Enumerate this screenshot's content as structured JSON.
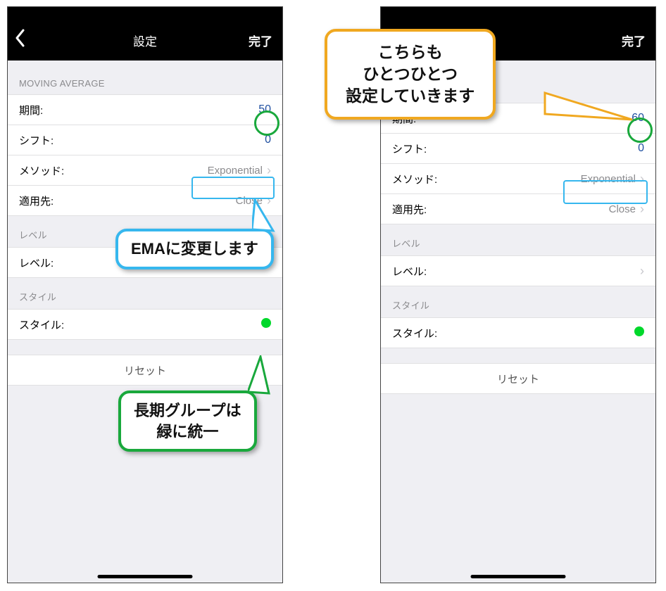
{
  "left": {
    "nav": {
      "back_icon_name": "chevron-left-icon",
      "title": "設定",
      "done": "完了"
    },
    "section1_header": "MOVING AVERAGE",
    "rows": {
      "period_label": "期間:",
      "period_value": "50",
      "shift_label": "シフト:",
      "shift_value": "0",
      "method_label": "メソッド:",
      "method_value": "Exponential",
      "apply_label": "適用先:",
      "apply_value": "Close"
    },
    "section2_header": "レベル",
    "level_label": "レベル:",
    "section3_header": "スタイル",
    "style_label": "スタイル:",
    "style_color": "#00d82b",
    "reset": "リセット"
  },
  "right": {
    "nav": {
      "done": "完了"
    },
    "rows": {
      "period_label": "期間:",
      "period_value": "60",
      "shift_label": "シフト:",
      "shift_value": "0",
      "method_label": "メソッド:",
      "method_value": "Exponential",
      "apply_label": "適用先:",
      "apply_value": "Close"
    },
    "section2_header": "レベル",
    "level_label": "レベル:",
    "section3_header": "スタイル",
    "style_label": "スタイル:",
    "style_color": "#00d82b",
    "reset": "リセット"
  },
  "callouts": {
    "blue": "EMAに変更します",
    "green_line1": "長期グループは",
    "green_line2": "緑に統一",
    "orange_line1": "こちらも",
    "orange_line2": "ひとつひとつ",
    "orange_line3": "設定していきます"
  }
}
